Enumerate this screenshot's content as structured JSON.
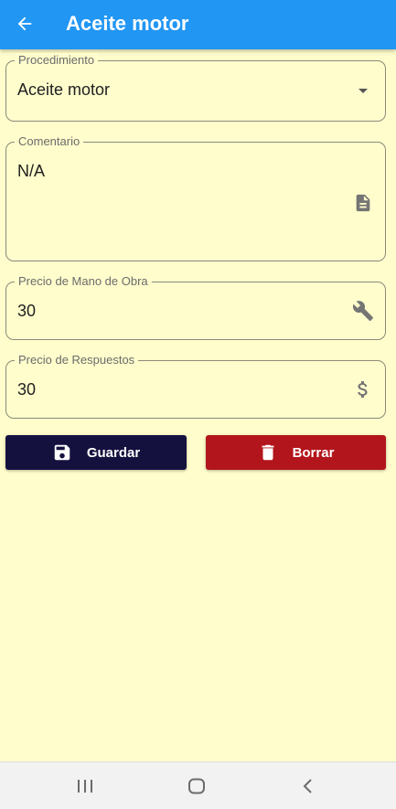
{
  "appbar": {
    "title": "Aceite motor",
    "back_icon": "arrow-left-icon",
    "background": "#2196f3"
  },
  "form": {
    "procedimiento": {
      "label": "Procedimiento",
      "value": "Aceite motor",
      "icon": "dropdown-arrow-icon"
    },
    "comentario": {
      "label": "Comentario",
      "value": "N/A",
      "icon": "document-icon"
    },
    "mano_obra": {
      "label": "Precio de Mano de Obra",
      "value": "30",
      "icon": "wrench-icon"
    },
    "repuestos": {
      "label": "Precio de Respuestos",
      "value": "30",
      "icon": "dollar-icon"
    }
  },
  "actions": {
    "save": {
      "label": "Guardar",
      "icon": "save-icon",
      "color": "#15113f"
    },
    "delete": {
      "label": "Borrar",
      "icon": "trash-icon",
      "color": "#b3151c"
    }
  },
  "navbar": {
    "items": [
      "recent-apps-icon",
      "home-icon",
      "back-icon"
    ]
  }
}
